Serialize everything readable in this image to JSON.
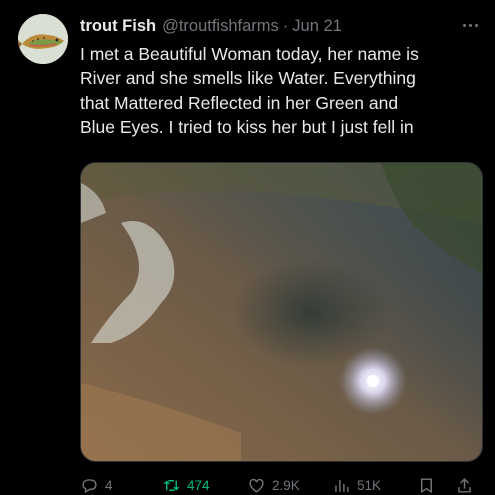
{
  "tweet": {
    "display_name": "trout Fish",
    "handle": "@troutfishfarms",
    "separator": "·",
    "date": "Jun 21",
    "text_lines": [
      "I met a Beautiful Woman today, her name is",
      "River and she smells like Water.  Everything",
      "that Mattered Reflected in her Green and",
      "Blue Eyes. I tried to kiss her but I just fell in"
    ],
    "media_icon": "river-water-photo",
    "avatar_icon": "trout-fish-avatar"
  },
  "actions": {
    "reply_count": "4",
    "retweet_count": "474",
    "like_count": "2.9K",
    "views_count": "51K",
    "retweet_color": "#00ba7c",
    "muted_color": "#71767b"
  },
  "colors": {
    "background": "#000000",
    "text": "#e7e9ea"
  }
}
